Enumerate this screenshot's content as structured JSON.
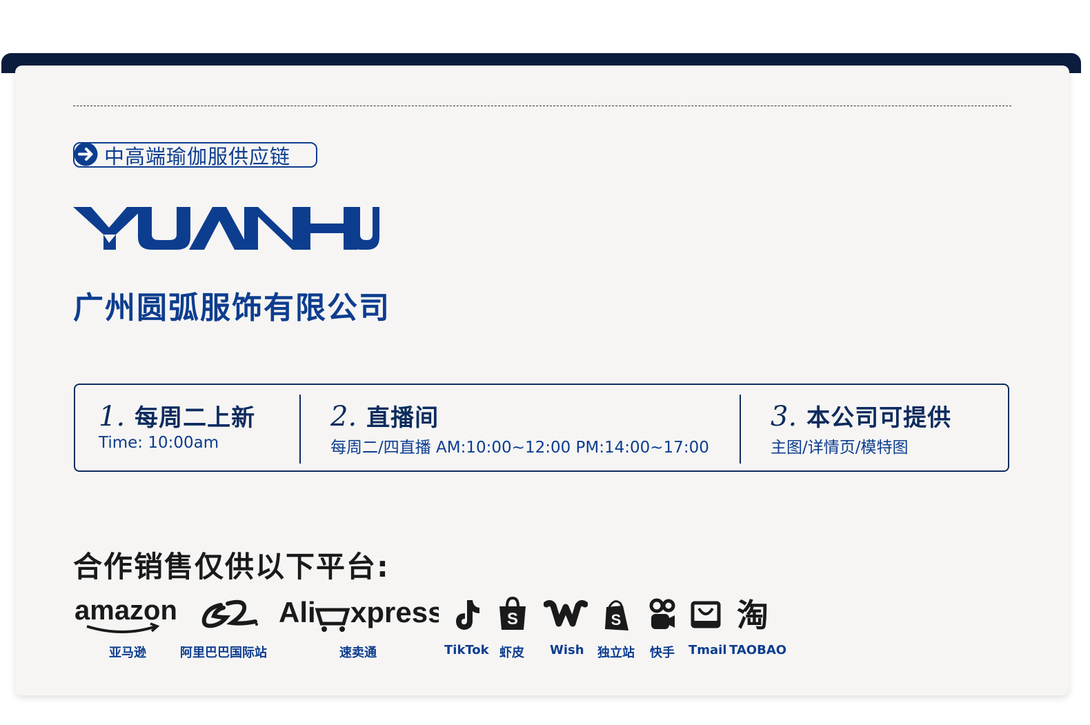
{
  "tag": {
    "text": "中高端瑜伽服供应链"
  },
  "brand": {
    "logo_text": "YUANHU",
    "company_name": "广州圆弧服饰有限公司"
  },
  "info": [
    {
      "num": "1.",
      "title": "每周二上新",
      "sub": "Time: 10:00am"
    },
    {
      "num": "2.",
      "title": "直播间",
      "sub": "每周二/四直播 AM:10:00~12:00 PM:14:00~17:00"
    },
    {
      "num": "3.",
      "title": "本公司可提供",
      "sub": "主图/详情页/模特图"
    }
  ],
  "platforms": {
    "title": "合作销售仅供以下平台:",
    "items": [
      {
        "label": "亚马逊",
        "logo_text": "amazon",
        "icon": "amazon-logo"
      },
      {
        "label": "阿里巴巴国际站",
        "icon": "alibaba-logo"
      },
      {
        "label": "速卖通",
        "logo_text": "AliExpress",
        "icon": "aliexpress-logo"
      },
      {
        "label": "TikTok",
        "icon": "tiktok-icon"
      },
      {
        "label": "虾皮",
        "icon": "shopee-icon"
      },
      {
        "label": "Wish",
        "icon": "wish-icon"
      },
      {
        "label": "独立站",
        "icon": "shopify-icon"
      },
      {
        "label": "快手",
        "icon": "kuaishou-icon"
      },
      {
        "label": "Tmail",
        "icon": "tmall-icon"
      },
      {
        "label": "TAOBAO",
        "logo_text": "淘",
        "icon": "taobao-icon"
      }
    ]
  },
  "colors": {
    "navy": "#0a1d3d",
    "brand_blue": "#0d3d8f",
    "card_bg": "#f6f5f4"
  }
}
